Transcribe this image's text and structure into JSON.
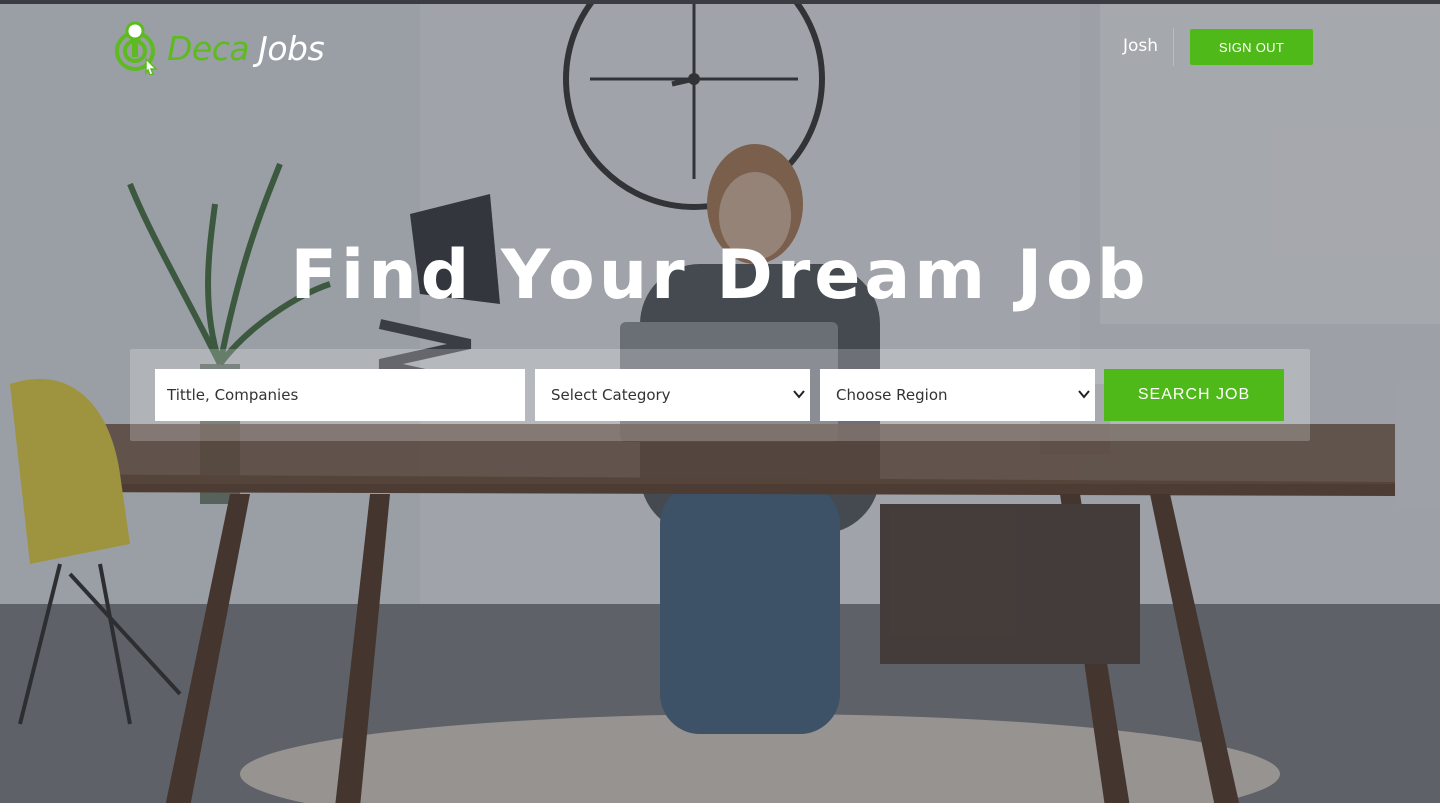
{
  "header": {
    "logo": {
      "word1": "Deca",
      "word2": "Jobs"
    },
    "user_name": "Josh",
    "signout_label": "SIGN OUT"
  },
  "hero": {
    "title": "Find Your Dream Job"
  },
  "search": {
    "keyword_placeholder": "Tittle, Companies",
    "category_selected": "Select Category",
    "region_selected": "Choose Region",
    "button_label": "SEARCH JOB"
  },
  "icons": {
    "logo": "deca-logo-icon",
    "select_chevron": "chevron-down-icon"
  },
  "colors": {
    "accent": "#50b91a",
    "logo_green": "#5dba1f",
    "overlay": "#3c404a"
  }
}
